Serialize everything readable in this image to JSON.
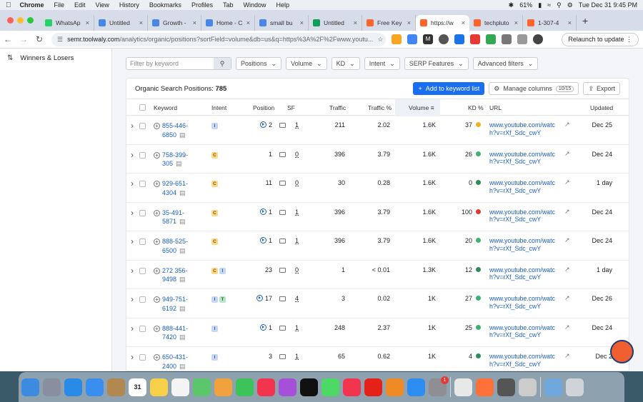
{
  "menubar": {
    "app": "Chrome",
    "items": [
      "File",
      "Edit",
      "View",
      "History",
      "Bookmarks",
      "Profiles",
      "Tab",
      "Window",
      "Help"
    ],
    "battery": "61%",
    "clock": "Tue Dec 31  9:45 PM"
  },
  "tabs": [
    {
      "label": "WhatsAp",
      "color": "#25d366"
    },
    {
      "label": "Untitled",
      "color": "#4a86e8"
    },
    {
      "label": "Growth -",
      "color": "#4a86e8"
    },
    {
      "label": "Home - C",
      "color": "#4a86e8"
    },
    {
      "label": "small bu",
      "color": "#4a86e8"
    },
    {
      "label": "Untitled",
      "color": "#0f9d58"
    },
    {
      "label": "Free Key",
      "color": "#ff642d"
    },
    {
      "label": "https://w",
      "color": "#ff642d",
      "active": true
    },
    {
      "label": "techpluto",
      "color": "#ff642d"
    },
    {
      "label": "1-307-4",
      "color": "#ff642d"
    }
  ],
  "toolbar": {
    "url_host": "semr.toolwaly.com",
    "url_rest": "/analytics/organic/positions?sortField=volume&db=us&q=https%3A%2F%2Fwww.youtu...",
    "relaunch": "Relaunch to update"
  },
  "sidebar": {
    "items": [
      {
        "label": "Winners & Losers",
        "icon": "sort-arrows-icon"
      }
    ]
  },
  "filters": {
    "search_placeholder": "Filter by keyword",
    "buttons": [
      "Positions",
      "Volume",
      "KD",
      "Intent",
      "SERP Features",
      "Advanced filters"
    ]
  },
  "card": {
    "title": "Organic Search Positions:",
    "count": "785",
    "add_button": "Add to keyword list",
    "manage_columns": "Manage columns",
    "columns_count": "10/15",
    "export": "Export"
  },
  "table": {
    "headers": {
      "keyword": "Keyword",
      "intent": "Intent",
      "position": "Position",
      "sf": "SF",
      "traffic": "Traffic",
      "traffic_pct": "Traffic %",
      "volume": "Volume",
      "kd": "KD %",
      "url": "URL",
      "updated": "Updated"
    },
    "sorted_by": "volume",
    "rows": [
      {
        "kw1": "855-446-",
        "kw2": "6850",
        "intent": [
          "I"
        ],
        "pos": "2",
        "play": true,
        "sf": "1",
        "traffic": "211",
        "tpct": "2.02",
        "vol": "1.6K",
        "kd": "37",
        "kdc": "#f2b01e",
        "url1": "www.youtube.com/watc",
        "url2": "h?v=rXf_Sdc_cwY",
        "upd": "Dec 25"
      },
      {
        "kw1": "758-399-",
        "kw2": "305",
        "intent": [
          "C"
        ],
        "pos": "1",
        "play": false,
        "sf": "0",
        "traffic": "396",
        "tpct": "3.79",
        "vol": "1.6K",
        "kd": "26",
        "kdc": "#3bb273",
        "url1": "www.youtube.com/watc",
        "url2": "h?v=rXf_Sdc_cwY",
        "upd": "Dec 24"
      },
      {
        "kw1": "929-651-",
        "kw2": "4304",
        "intent": [
          "C"
        ],
        "pos": "11",
        "play": false,
        "sf": "0",
        "traffic": "30",
        "tpct": "0.28",
        "vol": "1.6K",
        "kd": "0",
        "kdc": "#2e8b5a",
        "url1": "www.youtube.com/watc",
        "url2": "h?v=rXf_Sdc_cwY",
        "upd": "1 day"
      },
      {
        "kw1": "35-491-",
        "kw2": "5871",
        "intent": [
          "C"
        ],
        "pos": "1",
        "play": true,
        "sf": "1",
        "traffic": "396",
        "tpct": "3.79",
        "vol": "1.6K",
        "kd": "100",
        "kdc": "#e2392f",
        "url1": "www.youtube.com/watc",
        "url2": "h?v=rXf_Sdc_cwY",
        "upd": "Dec 24"
      },
      {
        "kw1": "888-525-",
        "kw2": "6500",
        "intent": [
          "C"
        ],
        "pos": "1",
        "play": true,
        "sf": "1",
        "traffic": "396",
        "tpct": "3.79",
        "vol": "1.6K",
        "kd": "20",
        "kdc": "#3bb273",
        "url1": "www.youtube.com/watc",
        "url2": "h?v=rXf_Sdc_cwY",
        "upd": "Dec 24"
      },
      {
        "kw1": "272 356-",
        "kw2": "9498",
        "intent": [
          "C",
          "I"
        ],
        "pos": "23",
        "play": false,
        "sf": "0",
        "traffic": "1",
        "tpct": "< 0.01",
        "vol": "1.3K",
        "kd": "12",
        "kdc": "#2e8b5a",
        "url1": "www.youtube.com/watc",
        "url2": "h?v=rXf_Sdc_cwY",
        "upd": "1 day"
      },
      {
        "kw1": "949-751-",
        "kw2": "6192",
        "intent": [
          "I",
          "T"
        ],
        "pos": "17",
        "play": true,
        "sf": "4",
        "traffic": "3",
        "tpct": "0.02",
        "vol": "1K",
        "kd": "27",
        "kdc": "#3bb273",
        "url1": "www.youtube.com/watc",
        "url2": "h?v=rXf_Sdc_cwY",
        "upd": "Dec 26"
      },
      {
        "kw1": "888-441-",
        "kw2": "7420",
        "intent": [
          "I"
        ],
        "pos": "1",
        "play": true,
        "sf": "1",
        "traffic": "248",
        "tpct": "2.37",
        "vol": "1K",
        "kd": "25",
        "kdc": "#3bb273",
        "url1": "www.youtube.com/watc",
        "url2": "h?v=rXf_Sdc_cwY",
        "upd": "Dec 24"
      },
      {
        "kw1": "650-431-",
        "kw2": "2400",
        "intent": [
          "I"
        ],
        "pos": "3",
        "play": false,
        "sf": "1",
        "traffic": "65",
        "tpct": "0.62",
        "vol": "1K",
        "kd": "4",
        "kdc": "#2e8b5a",
        "url1": "www.youtube.com/watc",
        "url2": "h?v=rXf_Sdc_cwY",
        "upd": "Dec 2"
      }
    ]
  },
  "dock": {
    "apps": [
      {
        "name": "finder-icon",
        "color": "#3d8be0"
      },
      {
        "name": "launchpad-icon",
        "color": "#8a8fa0"
      },
      {
        "name": "safari-icon",
        "color": "#2a8ae8"
      },
      {
        "name": "mail-icon",
        "color": "#3a8ef0"
      },
      {
        "name": "contacts-icon",
        "color": "#b08850"
      },
      {
        "name": "calendar-icon",
        "color": "#ffffff",
        "text": "31"
      },
      {
        "name": "notes-icon",
        "color": "#f7d04a"
      },
      {
        "name": "reminders-icon",
        "color": "#f4f4f4"
      },
      {
        "name": "maps-icon",
        "color": "#5cc66a"
      },
      {
        "name": "photos-icon",
        "color": "#f2a23c"
      },
      {
        "name": "facetime-icon",
        "color": "#3cc45a"
      },
      {
        "name": "music-icon",
        "color": "#f2344f"
      },
      {
        "name": "podcasts-icon",
        "color": "#a64fd8"
      },
      {
        "name": "tv-icon",
        "color": "#111111"
      },
      {
        "name": "messages-icon",
        "color": "#4cd964"
      },
      {
        "name": "news-icon",
        "color": "#f2344f"
      },
      {
        "name": "youtube-icon",
        "color": "#e62117"
      },
      {
        "name": "books-icon",
        "color": "#f08a24"
      },
      {
        "name": "app-store-icon",
        "color": "#2d8cf0"
      },
      {
        "name": "system-settings-icon",
        "color": "#8e8e93",
        "badge": "1"
      },
      {
        "name": "chrome-icon",
        "color": "#e8e8e8"
      },
      {
        "name": "firefox-icon",
        "color": "#ff7139"
      },
      {
        "name": "calculator-icon",
        "color": "#555555"
      },
      {
        "name": "preview-icon",
        "color": "#cccccc"
      },
      {
        "name": "downloads-icon",
        "color": "#6fa8dc"
      },
      {
        "name": "trash-icon",
        "color": "#d0d4d8"
      }
    ]
  }
}
